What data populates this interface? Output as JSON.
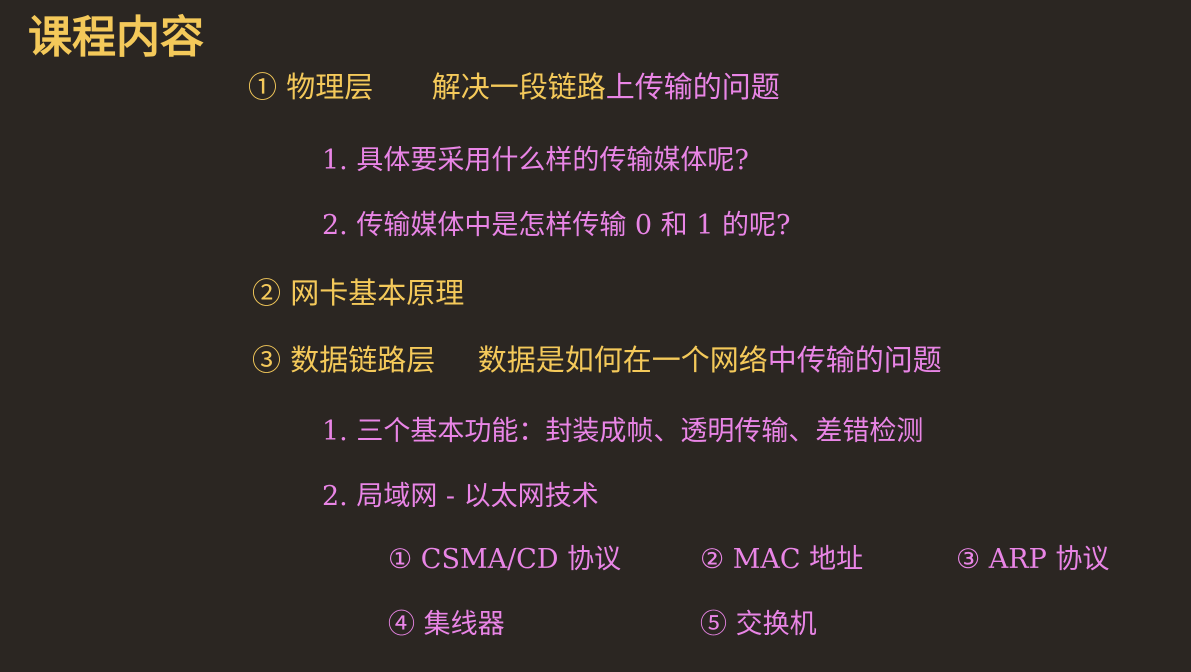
{
  "title": "课程内容",
  "sections": {
    "physical": {
      "number": "①",
      "name": "物理层",
      "desc_part1": "解决一段链路",
      "desc_part2": "上传输的问题",
      "items": [
        "1. 具体要采用什么样的传输媒体呢?",
        "2. 传输媒体中是怎样传输 0 和 1 的呢?"
      ]
    },
    "nic": {
      "number": "②",
      "name": "网卡基本原理"
    },
    "datalink": {
      "number": "③",
      "name": "数据链路层",
      "desc_part1": "数据是如何在一个网络",
      "desc_part2": "中传输的问题",
      "items": [
        "1. 三个基本功能：封装成帧、透明传输、差错检测",
        "2. 局域网 - 以太网技术"
      ],
      "subitems": [
        "① CSMA/CD 协议",
        "② MAC 地址",
        "③ ARP 协议",
        "④ 集线器",
        "⑤ 交换机"
      ]
    }
  },
  "colors": {
    "background": "#2b2622",
    "heading_yellow": "#f4c95a",
    "text_pink": "#e985e6"
  }
}
